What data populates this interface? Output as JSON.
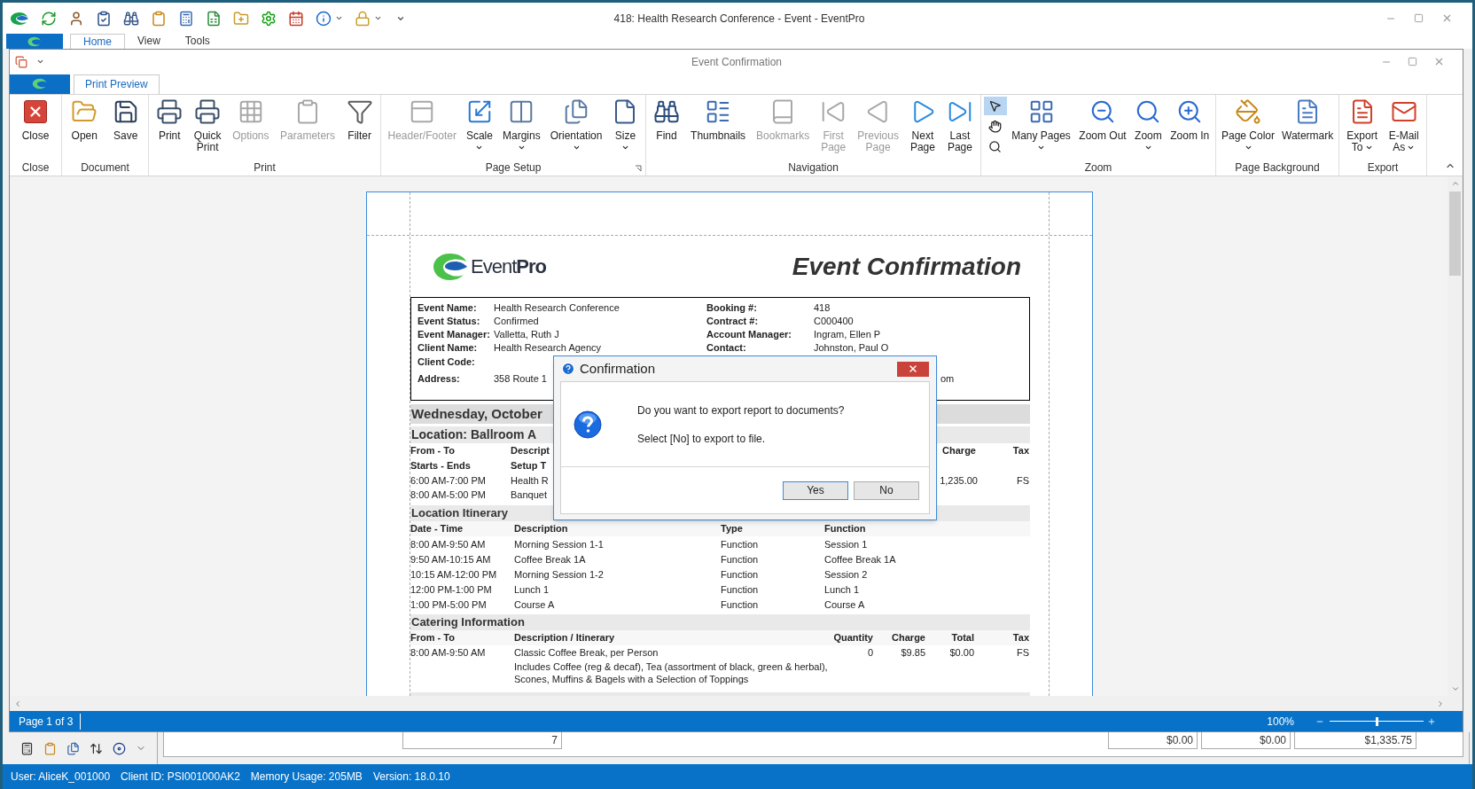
{
  "app": {
    "title": "418: Health Research Conference - Event - EventPro",
    "tabs": [
      {
        "label": "Home",
        "selected": true
      },
      {
        "label": "View",
        "selected": false
      },
      {
        "label": "Tools",
        "selected": false
      }
    ]
  },
  "window": {
    "title": "Event Confirmation",
    "tabs": [
      {
        "label": "Print Preview",
        "selected": true
      }
    ]
  },
  "ribbon": {
    "groups": [
      {
        "label": "Close",
        "buttons": [
          {
            "label": "Close",
            "disabled": false,
            "dropdown": false
          }
        ]
      },
      {
        "label": "Document",
        "buttons": [
          {
            "label": "Open",
            "disabled": false,
            "dropdown": false
          },
          {
            "label": "Save",
            "disabled": false,
            "dropdown": false
          }
        ]
      },
      {
        "label": "Print",
        "buttons": [
          {
            "label": "Print",
            "disabled": false,
            "dropdown": false
          },
          {
            "label": "Quick\nPrint",
            "disabled": false,
            "dropdown": false
          },
          {
            "label": "Options",
            "disabled": true,
            "dropdown": false
          },
          {
            "label": "Parameters",
            "disabled": true,
            "dropdown": false
          },
          {
            "label": "Filter",
            "disabled": false,
            "dropdown": false
          }
        ]
      },
      {
        "label": "Page Setup",
        "launcher": true,
        "buttons": [
          {
            "label": "Header/Footer",
            "disabled": true,
            "dropdown": false
          },
          {
            "label": "Scale",
            "disabled": false,
            "dropdown": true
          },
          {
            "label": "Margins",
            "disabled": false,
            "dropdown": true
          },
          {
            "label": "Orientation",
            "disabled": false,
            "dropdown": true
          },
          {
            "label": "Size",
            "disabled": false,
            "dropdown": true
          }
        ]
      },
      {
        "label": "Navigation",
        "buttons": [
          {
            "label": "Find",
            "disabled": false,
            "dropdown": false
          },
          {
            "label": "Thumbnails",
            "disabled": false,
            "dropdown": false
          },
          {
            "label": "Bookmarks",
            "disabled": true,
            "dropdown": false
          },
          {
            "label": "First\nPage",
            "disabled": true,
            "dropdown": false
          },
          {
            "label": "Previous\nPage",
            "disabled": true,
            "dropdown": false
          },
          {
            "label": "Next\nPage",
            "disabled": false,
            "dropdown": false
          },
          {
            "label": "Last\nPage",
            "disabled": false,
            "dropdown": false
          }
        ]
      },
      {
        "label": "Zoom",
        "tools": [
          {
            "selected": true
          },
          {
            "selected": false
          },
          {
            "selected": false
          }
        ],
        "buttons": [
          {
            "label": "Many Pages",
            "disabled": false,
            "dropdown": true
          },
          {
            "label": "Zoom Out",
            "disabled": false,
            "dropdown": false
          },
          {
            "label": "Zoom",
            "disabled": false,
            "dropdown": true
          },
          {
            "label": "Zoom In",
            "disabled": false,
            "dropdown": false
          }
        ]
      },
      {
        "label": "Page Background",
        "buttons": [
          {
            "label": "Page Color",
            "disabled": false,
            "dropdown": true
          },
          {
            "label": "Watermark",
            "disabled": false,
            "dropdown": false
          }
        ]
      },
      {
        "label": "Export",
        "buttons": [
          {
            "label": "Export\nTo",
            "disabled": false,
            "dropdown": true
          },
          {
            "label": "E-Mail\nAs",
            "disabled": false,
            "dropdown": true
          }
        ]
      }
    ]
  },
  "document": {
    "logo": "Event**Pro**",
    "title": "Event Confirmation",
    "info": [
      {
        "left": {
          "label": "Event Name:",
          "value": "Health Research Conference"
        },
        "right": {
          "label": "Booking #:",
          "value": "418"
        }
      },
      {
        "left": {
          "label": "Event Status:",
          "value": "Confirmed"
        },
        "right": {
          "label": "Contract #:",
          "value": "C000400"
        }
      },
      {
        "left": {
          "label": "Event Manager:",
          "value": "Valletta, Ruth J"
        },
        "right": {
          "label": "Account Manager:",
          "value": "Ingram, Ellen P"
        }
      },
      {
        "left": {
          "label": "Client Name:",
          "value": "Health Research Agency"
        },
        "right": {
          "label": "Contact:",
          "value": "Johnston, Paul O"
        }
      },
      {
        "left": {
          "label": "Client Code:"
        }
      },
      {
        "left": {
          "label": "Address:",
          "value": "358 Route 1"
        },
        "right": {
          "value": "om"
        }
      }
    ],
    "day_header": "Wednesday, October",
    "location": "Location: Ballroom A",
    "location_table": {
      "header_rows": [
        {
          "date": "From - To",
          "description": "Descript",
          "charge": "Charge",
          "tax": "Tax"
        },
        {
          "date": "Starts - Ends",
          "description": "Setup T"
        }
      ],
      "rows": [
        {
          "date": "6:00 AM-7:00 PM",
          "description": "Health R",
          "charge": "1,235.00",
          "tax": "FS"
        },
        {
          "date": "8:00 AM-5:00 PM",
          "description": "Banquet"
        }
      ]
    },
    "itinerary": {
      "title": "Location Itinerary",
      "columns": [
        "Date - Time",
        "Description",
        "Type",
        "Function"
      ],
      "rows": [
        [
          "8:00 AM-9:50 AM",
          "Morning Session 1-1",
          "Function",
          "Session 1"
        ],
        [
          "9:50 AM-10:15 AM",
          "Coffee Break 1A",
          "Function",
          "Coffee Break 1A"
        ],
        [
          "10:15 AM-12:00 PM",
          "Morning Session 1-2",
          "Function",
          "Session 2"
        ],
        [
          "12:00 PM-1:00 PM",
          "Lunch 1",
          "Function",
          "Lunch 1"
        ],
        [
          "1:00 PM-5:00 PM",
          "Course A",
          "Function",
          "Course A"
        ]
      ]
    },
    "catering": {
      "title": "Catering Information",
      "columns": [
        "From - To",
        "Description / Itinerary",
        "Quantity",
        "Charge",
        "Total",
        "Tax"
      ],
      "rows": [
        {
          "cells": [
            "8:00 AM-9:50 AM",
            "Classic Coffee Break, per Person",
            "0",
            "$9.85",
            "$0.00",
            "FS"
          ],
          "note": "Includes Coffee (reg & decaf), Tea (assortment of black, green & herbal),\nScones, Muffins & Bagels with a Selection of Toppings"
        }
      ]
    }
  },
  "dialog": {
    "title": "Confirmation",
    "message": "Do you want to export report to documents?",
    "hint": "Select [No] to export to file.",
    "buttons": [
      {
        "label": "Yes",
        "default": true
      },
      {
        "label": "No",
        "default": false
      }
    ]
  },
  "status_bar": {
    "page": "Page 1 of 3",
    "zoom": "100%",
    "zoom_slider": {
      "level": 0.5
    }
  },
  "summary_row": {
    "cells": [
      "7",
      "$0.00",
      "$0.00",
      "$1,335.75"
    ]
  },
  "app_status": [
    "User: AliceK_001000",
    "Client ID: PSI001000AK2",
    "Memory Usage: 205MB",
    "Version: 18.0.10"
  ]
}
